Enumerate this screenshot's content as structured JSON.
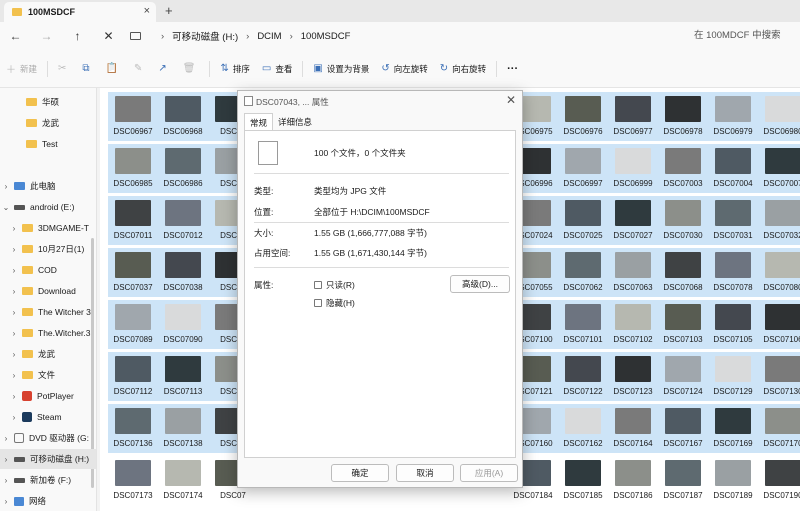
{
  "window": {
    "tab_title": "100MSDCF",
    "new_tab": "+",
    "close_tab": "×",
    "controls": [
      "—",
      "☐",
      "✕"
    ]
  },
  "nav": {
    "back": "←",
    "forward": "→",
    "up": "↑",
    "refresh": "✕",
    "breadcrumb": [
      "可移动磁盘 (H:)",
      "DCIM",
      "100MSDCF"
    ],
    "search_placeholder": "在 100MDCF 中搜索"
  },
  "toolbar": {
    "new": "新建",
    "sort": "排序",
    "view": "查看",
    "set_wallpaper": "设置为背景",
    "rotate_left": "向左旋转",
    "rotate_right": "向右旋转",
    "more": "···",
    "icons": {
      "new": "＋",
      "cut": "✂",
      "copy": "⧉",
      "paste": "📋",
      "rename": "✎",
      "share": "↗",
      "delete": "🗑",
      "sort": "⇅",
      "view": "▭",
      "set_wallpaper": "▣",
      "rotate_left": "↺",
      "rotate_right": "↻"
    }
  },
  "sidebar": {
    "items": [
      {
        "label": "华硕",
        "icon": "folder-icon"
      },
      {
        "label": "龙武",
        "icon": "folder-icon"
      },
      {
        "label": "Test",
        "icon": "folder-icon"
      },
      {
        "label": "此电脑",
        "icon": "computer-icon",
        "expand": "›"
      },
      {
        "label": "android (E:)",
        "icon": "drive-icon",
        "expand": "⌄"
      },
      {
        "label": "3DMGAME-T",
        "icon": "folder-icon",
        "expand": "›"
      },
      {
        "label": "10月27日(1)",
        "icon": "folder-icon",
        "expand": "›"
      },
      {
        "label": "COD",
        "icon": "folder-icon",
        "expand": "›"
      },
      {
        "label": "Download",
        "icon": "folder-icon",
        "expand": "›"
      },
      {
        "label": "The Witcher 3",
        "icon": "folder-icon",
        "expand": "›"
      },
      {
        "label": "The.Witcher.3",
        "icon": "folder-icon",
        "expand": "›"
      },
      {
        "label": "龙武",
        "icon": "folder-icon",
        "expand": "›"
      },
      {
        "label": "文件",
        "icon": "folder-icon",
        "expand": "›"
      },
      {
        "label": "PotPlayer",
        "icon": "potplayer-icon",
        "expand": "›"
      },
      {
        "label": "Steam",
        "icon": "steam-icon",
        "expand": "›"
      },
      {
        "label": "DVD 驱动器 (G:",
        "icon": "dvd-icon",
        "expand": "›"
      },
      {
        "label": "可移动磁盘 (H:)",
        "icon": "drive-icon",
        "expand": "›",
        "selected": true
      },
      {
        "label": "新加卷 (F:)",
        "icon": "drive-icon",
        "expand": "›"
      },
      {
        "label": "网络",
        "icon": "network-icon",
        "expand": "›"
      }
    ]
  },
  "files": {
    "rows": [
      [
        "DSC06967",
        "DSC06968",
        "DSC06",
        "",
        "",
        "",
        "",
        "",
        "DSC06975",
        "DSC06976",
        "DSC06977",
        "DSC06978",
        "DSC06979",
        "DSC06980"
      ],
      [
        "DSC06985",
        "DSC06986",
        "DSC06",
        "",
        "",
        "",
        "",
        "",
        "DSC06996",
        "DSC06997",
        "DSC06999",
        "DSC07003",
        "DSC07004",
        "DSC07007"
      ],
      [
        "DSC07011",
        "DSC07012",
        "DSC07",
        "",
        "",
        "",
        "",
        "",
        "DSC07024",
        "DSC07025",
        "DSC07027",
        "DSC07030",
        "DSC07031",
        "DSC07032"
      ],
      [
        "DSC07037",
        "DSC07038",
        "DSC07",
        "",
        "",
        "",
        "",
        "",
        "DSC07055",
        "DSC07062",
        "DSC07063",
        "DSC07068",
        "DSC07078",
        "DSC07080"
      ],
      [
        "DSC07089",
        "DSC07090",
        "DSC07",
        "",
        "",
        "",
        "",
        "",
        "DSC07100",
        "DSC07101",
        "DSC07102",
        "DSC07103",
        "DSC07105",
        "DSC07106"
      ],
      [
        "DSC07112",
        "DSC07113",
        "DSC07",
        "",
        "",
        "",
        "",
        "",
        "DSC07121",
        "DSC07122",
        "DSC07123",
        "DSC07124",
        "DSC07129",
        "DSC07130"
      ],
      [
        "DSC07136",
        "DSC07138",
        "DSC07",
        "",
        "",
        "",
        "",
        "",
        "DSC07160",
        "DSC07162",
        "DSC07164",
        "DSC07167",
        "DSC07169",
        "DSC07170"
      ],
      [
        "DSC07173",
        "DSC07174",
        "DSC07",
        "",
        "",
        "",
        "",
        "",
        "DSC07184",
        "DSC07185",
        "DSC07186",
        "DSC07187",
        "DSC07189",
        "DSC07190"
      ]
    ],
    "thumb_colors": [
      "#7a7a7a",
      "#4f5a63",
      "#2f3a3e",
      "#8c8f8a",
      "#5e6a70",
      "#9aa0a3",
      "#3f4244",
      "#6d7480",
      "#b6b8b0",
      "#585c52",
      "#44484f",
      "#2e3133",
      "#a0a7ad",
      "#d9dadb"
    ]
  },
  "dialog": {
    "title": "DSC07043, ... 属性",
    "close": "✕",
    "tabs": [
      "常规",
      "详细信息"
    ],
    "summary": "100 个文件，0 个文件夹",
    "type_label": "类型:",
    "type_value": "类型均为 JPG 文件",
    "location_label": "位置:",
    "location_value": "全部位于 H:\\DCIM\\100MSDCF",
    "size_label": "大小:",
    "size_value": "1.55 GB (1,666,777,088 字节)",
    "disk_label": "占用空间:",
    "disk_value": "1.55 GB (1,671,430,144 字节)",
    "attr_label": "属性:",
    "readonly": "只读(R)",
    "hidden": "隐藏(H)",
    "advanced": "高级(D)...",
    "ok": "确定",
    "cancel": "取消",
    "apply": "应用(A)"
  }
}
